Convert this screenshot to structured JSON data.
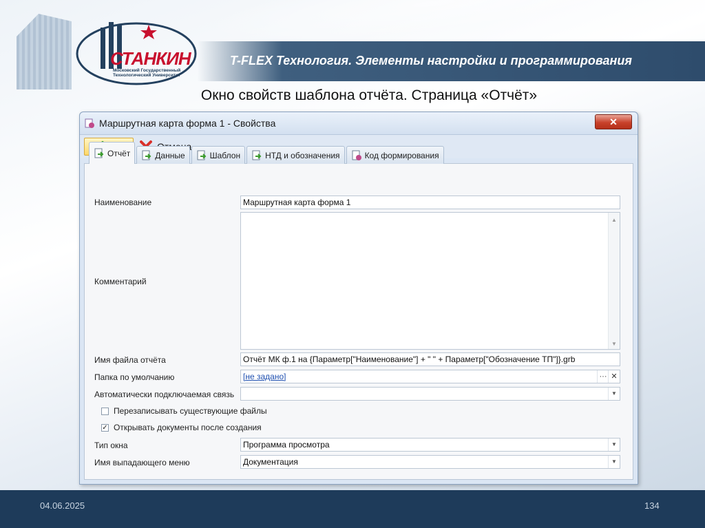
{
  "slide": {
    "header_title": "T-FLEX Технология. Элементы настройки и программирования",
    "page_title": "Окно свойств шаблона отчёта. Страница «Отчёт»",
    "logo_text": "СТАНКИН",
    "logo_subtitle": "Московский Государственный Технологический Университет",
    "footer_date": "04.06.2025",
    "footer_page": "134",
    "colors": {
      "header_band": "#2e4c6c",
      "footer_band": "#1e3b5a",
      "logo_red": "#c8102e"
    }
  },
  "dialog": {
    "title": "Маршрутная карта форма 1 - Свойства",
    "close_label": "✕",
    "toolbar": {
      "ok_label": "OK",
      "cancel_label": "Отмена"
    },
    "tabs": [
      {
        "label": "Отчёт",
        "icon": "report-tab-icon",
        "active": true
      },
      {
        "label": "Данные",
        "icon": "data-tab-icon"
      },
      {
        "label": "Шаблон",
        "icon": "template-tab-icon"
      },
      {
        "label": "НТД и обозначения",
        "icon": "ntd-tab-icon"
      },
      {
        "label": "Код формирования",
        "icon": "code-tab-icon"
      }
    ],
    "fields": {
      "name": {
        "label": "Наименование",
        "value": "Маршрутная карта форма 1"
      },
      "comment": {
        "label": "Комментарий",
        "value": ""
      },
      "filename": {
        "label": "Имя файла отчёта",
        "value": "Отчёт МК ф.1 на {Параметр[\"Наименование\"] + \" \" + Параметр[\"Обозначение ТП\"]}.grb"
      },
      "folder": {
        "label": "Папка по умолчанию",
        "value": "[не задано]",
        "browse_label": "···",
        "clear_label": "✕"
      },
      "auto_link": {
        "label": "Автоматически подключаемая связь",
        "value": ""
      },
      "overwrite": {
        "label": "Перезаписывать существующие файлы",
        "checked": false
      },
      "open_after": {
        "label": "Открывать документы после создания",
        "checked": true,
        "check_mark": "✓"
      },
      "window_type": {
        "label": "Тип окна",
        "value": "Программа просмотра"
      },
      "menu_name": {
        "label": "Имя выпадающего меню",
        "value": "Документация"
      }
    }
  }
}
